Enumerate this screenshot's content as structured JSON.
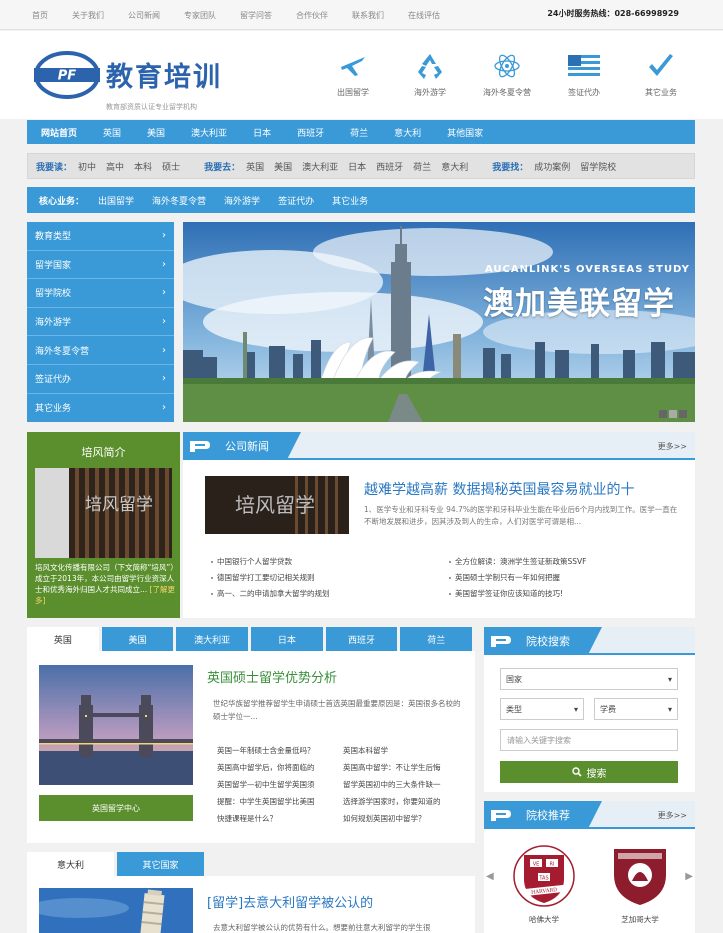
{
  "topbar": {
    "links": [
      "首页",
      "关于我们",
      "公司新闻",
      "专家团队",
      "留学问答",
      "合作伙伴",
      "联系我们",
      "在线评估"
    ],
    "hotline": "24小时服务热线：028-66998929"
  },
  "header": {
    "logo_mark": "PF",
    "brand": "教育培训",
    "slogan": "教育部资质认证专业留学机构",
    "services": [
      {
        "label": "出国留学",
        "icon": "airplane-icon"
      },
      {
        "label": "海外游学",
        "icon": "recycle-icon"
      },
      {
        "label": "海外冬夏令营",
        "icon": "atom-icon"
      },
      {
        "label": "签证代办",
        "icon": "us-flag-icon"
      },
      {
        "label": "其它业务",
        "icon": "checkmark-icon"
      }
    ]
  },
  "mainnav": {
    "items": [
      "网站首页",
      "英国",
      "美国",
      "澳大利亚",
      "日本",
      "西班牙",
      "荷兰",
      "意大利",
      "其他国家"
    ]
  },
  "wantbar": {
    "read_label": "我要读：",
    "read_items": [
      "初中",
      "高中",
      "本科",
      "硕士"
    ],
    "go_label": "我要去：",
    "go_items": [
      "英国",
      "美国",
      "澳大利亚",
      "日本",
      "西班牙",
      "荷兰",
      "意大利"
    ],
    "find_label": "我要找：",
    "find_items": [
      "成功案例",
      "留学院校"
    ]
  },
  "corebar": {
    "label": "核心业务：",
    "items": [
      "出国留学",
      "海外冬夏令营",
      "海外游学",
      "签证代办",
      "其它业务"
    ]
  },
  "sidemenu": {
    "items": [
      "教育类型",
      "留学国家",
      "留学院校",
      "海外游学",
      "海外冬夏令营",
      "签证代办",
      "其它业务"
    ]
  },
  "banner": {
    "en": "AUCANLINK'S OVERSEAS STUDY",
    "cn": "澳加美联留学"
  },
  "culture": {
    "title": "培风简介",
    "photo_text": "培风留学",
    "text": "培风文化传播有限公司（下文简称“培风”）成立于2013年，本公司由留学行业资深人士和优秀海外归国人才共同成立...",
    "more": "[了解更多]"
  },
  "news": {
    "title": "公司新闻",
    "more": "更多>>",
    "photo_text": "培风留学",
    "headline": "越难学越高薪 数据揭秘英国最容易就业的十",
    "summary": "1、医学专业和牙科专业 94.7%的医学和牙科毕业生能在毕业后6个月内找到工作。医学一直在不断地发展和进步，因其涉及到人的生命，人们对医学可谓是相...",
    "items": [
      "中国银行个人留学贷款",
      "全方位解读：澳洲学生签证新政策SSVF",
      "德国留学打工要切记相关规则",
      "英国硕士学制只有一年如何把握",
      "高一、二的申请加拿大留学的规划",
      "美国留学签证你应该知道的技巧!"
    ]
  },
  "countrybox": {
    "tabs": [
      "英国",
      "美国",
      "澳大利亚",
      "日本",
      "西班牙",
      "荷兰"
    ],
    "active": 0,
    "photo_button": "英国留学中心",
    "headline": "英国硕士留学优势分析",
    "summary": "世纪华族留学推荐留学生申请硕士首选英国最重要原因是：英国很多名校的硕士学位一...",
    "items_left": [
      "英国一年制硕士含金量低吗？",
      "英国高中留学后，你将面临的",
      "英国留学—初中生留学英国须",
      "提醒：中学生英国留学比美国",
      "快捷课程是什么？"
    ],
    "items_right": [
      "英国本科留学",
      "英国高中留学：不让学生后悔",
      "留学英国初中的三大条件缺一",
      "选择游学国家时，你要知道的",
      "如何规划英国初中留学？"
    ]
  },
  "search": {
    "title": "院校搜索",
    "country": "国家",
    "type": "类型",
    "fee": "学费",
    "keyword_placeholder": "请输入关键字搜索",
    "button": "搜索"
  },
  "recommend": {
    "title": "院校推荐",
    "more": "更多>>",
    "schools": [
      "哈佛大学",
      "芝加哥大学"
    ],
    "harvard_letters": [
      "VE",
      "RI",
      "TAS"
    ],
    "harvard_band": "HARVARD"
  },
  "italybox": {
    "tabs": [
      "意大利",
      "其它国家"
    ],
    "active": 0,
    "headline": "[留学]去意大利留学被公认的",
    "summary": "去意大利留学被公认的优势有什么。想要前往意大利留学的学生很"
  },
  "colors": {
    "blue": "#3a9ad7",
    "green": "#5b8f2e",
    "brand_blue": "#2b63ad"
  }
}
